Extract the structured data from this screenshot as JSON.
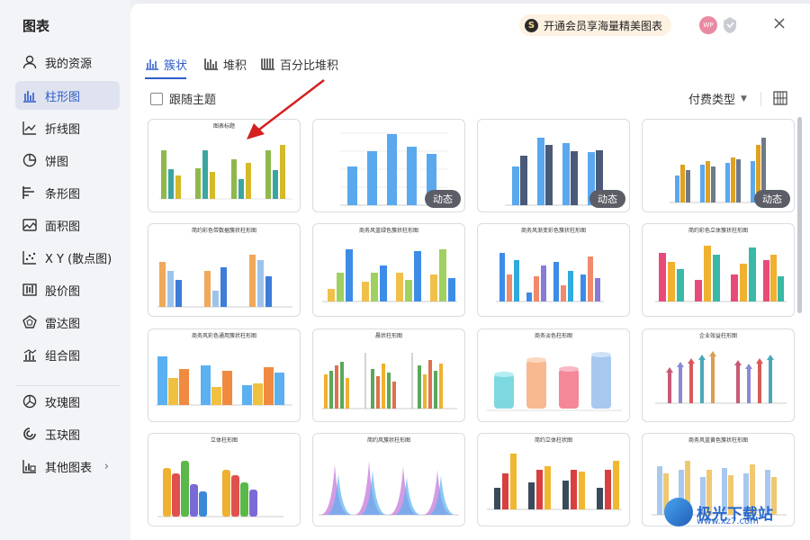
{
  "sidebar": {
    "title": "图表",
    "items": [
      {
        "label": "我的资源",
        "icon": "user-icon"
      },
      {
        "label": "柱形图",
        "icon": "column-chart-icon",
        "active": true
      },
      {
        "label": "折线图",
        "icon": "line-chart-icon"
      },
      {
        "label": "饼图",
        "icon": "pie-chart-icon"
      },
      {
        "label": "条形图",
        "icon": "bar-chart-icon"
      },
      {
        "label": "面积图",
        "icon": "area-chart-icon"
      },
      {
        "label": "X Y (散点图)",
        "icon": "scatter-chart-icon"
      },
      {
        "label": "股价图",
        "icon": "stock-chart-icon"
      },
      {
        "label": "雷达图",
        "icon": "radar-chart-icon"
      },
      {
        "label": "组合图",
        "icon": "combo-chart-icon"
      },
      {
        "label": "玫瑰图",
        "icon": "rose-chart-icon"
      },
      {
        "label": "玉玦图",
        "icon": "ring-chart-icon"
      },
      {
        "label": "其他图表",
        "icon": "other-chart-icon"
      }
    ]
  },
  "header": {
    "promo": "开通会员享海量精美图表",
    "avatar": "WP"
  },
  "tabs": [
    {
      "label": "簇状",
      "active": true
    },
    {
      "label": "堆积"
    },
    {
      "label": "百分比堆积"
    }
  ],
  "toolbar": {
    "follow_theme": "跟随主题",
    "pay_type": "付费类型"
  },
  "cards": [
    {
      "title": "图表标题",
      "badge": ""
    },
    {
      "title": "",
      "badge": "动态"
    },
    {
      "title": "",
      "badge": "动态"
    },
    {
      "title": "",
      "badge": "动态"
    },
    {
      "title": "简约彩色带数据簇状柱形图",
      "badge": ""
    },
    {
      "title": "商务风蓝绿色簇状柱形图",
      "badge": ""
    },
    {
      "title": "商务风渐变彩色簇状柱形图",
      "badge": ""
    },
    {
      "title": "简约彩色立体簇状柱形图",
      "badge": ""
    },
    {
      "title": "商务风彩色通用簇状柱形图",
      "badge": ""
    },
    {
      "title": "晨状柱形图",
      "badge": ""
    },
    {
      "title": "商务淡色柱形图",
      "badge": ""
    },
    {
      "title": "企业效益柱形图",
      "badge": ""
    },
    {
      "title": "立体柱形图",
      "badge": ""
    },
    {
      "title": "简约风簇状柱形图",
      "badge": ""
    },
    {
      "title": "简约立体柱状图",
      "badge": ""
    },
    {
      "title": "商务风蓝黄色簇状柱形图",
      "badge": ""
    }
  ],
  "watermark": {
    "text": "极光下载站",
    "sub": "www.xz7.com"
  },
  "colors": {
    "accent": "#2f5cc8",
    "badge_bg": "#5b5e66",
    "annotation_arrow": "#d42020"
  }
}
